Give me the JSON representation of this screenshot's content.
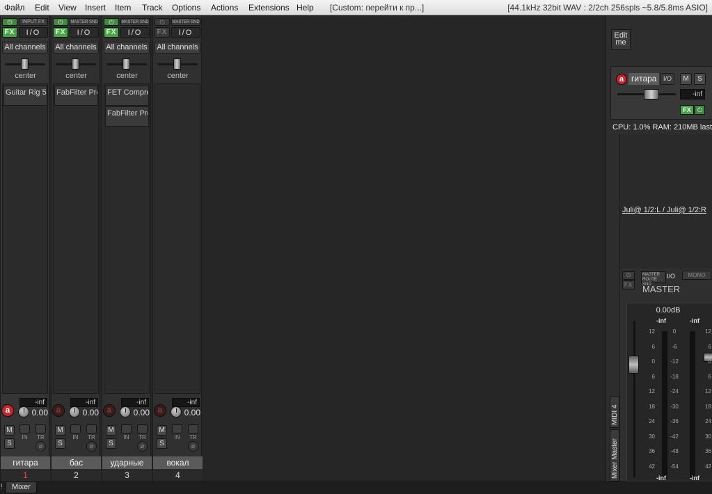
{
  "menu": {
    "items": [
      "Файл",
      "Edit",
      "View",
      "Insert",
      "Item",
      "Track",
      "Options",
      "Actions",
      "Extensions",
      "Help"
    ],
    "title": "[Custom: перейти к пр...]",
    "audio_status": "[44.1kHz 32bit WAV : 2/2ch 256spls ~5.8/5.8ms ASIO]"
  },
  "tracks": [
    {
      "name": "гитара",
      "number": "1",
      "selected": true,
      "route_label": "INPUT FX",
      "io_label": "I/O",
      "fx_label": "FX",
      "power_label": "⏻",
      "input": "All channels",
      "pan": "center",
      "fx": [
        "Guitar Rig 5"
      ],
      "peak": "-inf",
      "volume": "0.00",
      "rec_label": "a",
      "armed": true,
      "mute": "M",
      "solo": "S",
      "in_label": "IN",
      "tr_label": "TR",
      "fx_on": true
    },
    {
      "name": "бас",
      "number": "2",
      "selected": false,
      "route_label": "MASTER SND",
      "io_label": "I/O",
      "fx_label": "FX",
      "power_label": "⏻",
      "input": "All channels",
      "pan": "center",
      "fx": [
        "FabFilter Pro"
      ],
      "peak": "-inf",
      "volume": "0.00",
      "rec_label": "a",
      "armed": false,
      "mute": "M",
      "solo": "S",
      "in_label": "IN",
      "tr_label": "TR",
      "fx_on": true
    },
    {
      "name": "ударные",
      "number": "3",
      "selected": false,
      "route_label": "MASTER SND",
      "io_label": "I/O",
      "fx_label": "FX",
      "power_label": "⏻",
      "input": "All channels",
      "pan": "center",
      "fx": [
        "FET Compre",
        "FabFilter Pro"
      ],
      "peak": "-inf",
      "volume": "0.00",
      "rec_label": "a",
      "armed": false,
      "mute": "M",
      "solo": "S",
      "in_label": "IN",
      "tr_label": "TR",
      "fx_on": true
    },
    {
      "name": "вокал",
      "number": "4",
      "selected": false,
      "route_label": "MASTER SND",
      "io_label": "I/O",
      "fx_label": "FX",
      "power_label": "⏻",
      "input": "All channels",
      "pan": "center",
      "fx": [],
      "peak": "-inf",
      "volume": "0.00",
      "rec_label": "a",
      "armed": false,
      "mute": "M",
      "solo": "S",
      "in_label": "IN",
      "tr_label": "TR",
      "fx_on": false
    }
  ],
  "bottom": {
    "mixer_tab": "Mixer",
    "marker": "!"
  },
  "dock": {
    "edit_me": "Edit me",
    "tcp": {
      "rec_label": "a",
      "name": "гитара",
      "io": "I/O",
      "mute": "M",
      "solo": "S",
      "peak": "-inf",
      "fx": "FX",
      "power": "⏻"
    },
    "performance": "CPU: 1.0%  RAM: 210MB  last",
    "hardware_out": "Juli@ 1/2:L / Juli@ 1/2:R",
    "tabs": [
      "MIDI 4",
      "Mixer Master"
    ],
    "master": {
      "power": "⏻",
      "fx": "FX",
      "route": "MASTER ROUTE SND",
      "io": "I/O",
      "mono": "MONO",
      "name": "MASTER",
      "volume_db": "0.00dB",
      "peak_left": "-inf",
      "peak_right": "-inf",
      "bottom_left": "-inf",
      "bottom_right": "-inf",
      "fader_scale": [
        "12",
        "6",
        "0",
        "6",
        "12",
        "18",
        "24",
        "30",
        "36",
        "42"
      ],
      "meter_scale": [
        "0",
        "-6",
        "-12",
        "-18",
        "-24",
        "-30",
        "-36",
        "-42",
        "-48",
        "-54"
      ],
      "right_scale": [
        "12",
        "6",
        "0",
        "6",
        "12",
        "18",
        "24",
        "30",
        "36",
        "42"
      ]
    }
  },
  "colors": {
    "selected_track_number": "#e0504a",
    "armed": "#c8262a",
    "fx_active": "#4aa54a",
    "background": "#262626"
  }
}
